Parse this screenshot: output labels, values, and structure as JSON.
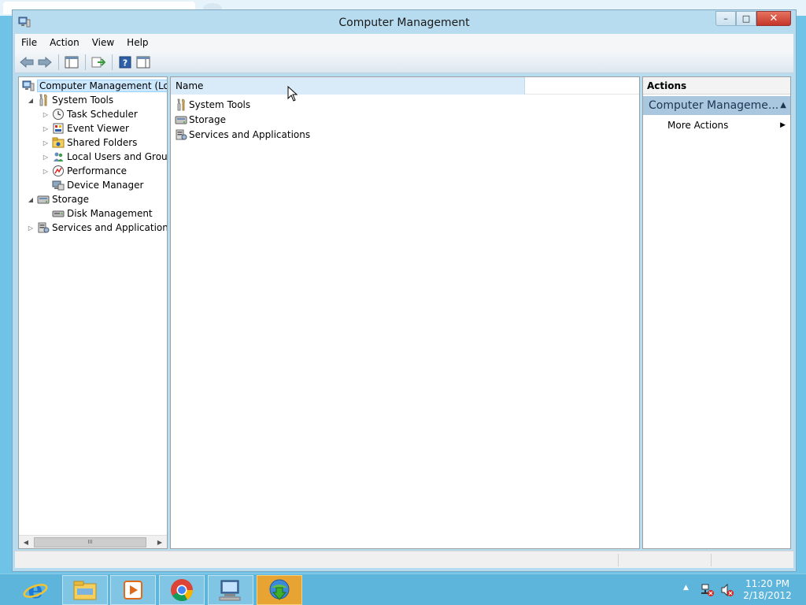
{
  "window": {
    "title": "Computer Management",
    "minimize_label": "–",
    "maximize_label": "□",
    "close_label": "✕"
  },
  "menu": [
    "File",
    "Action",
    "View",
    "Help"
  ],
  "tree": {
    "items": [
      {
        "label": "Computer Management (Local",
        "level": 0,
        "expander": "",
        "icon": "computer-management-icon",
        "selected": true
      },
      {
        "label": "System Tools",
        "level": 1,
        "expander": "◢",
        "icon": "tools-icon"
      },
      {
        "label": "Task Scheduler",
        "level": 2,
        "expander": "▷",
        "icon": "clock-icon"
      },
      {
        "label": "Event Viewer",
        "level": 2,
        "expander": "▷",
        "icon": "event-viewer-icon"
      },
      {
        "label": "Shared Folders",
        "level": 2,
        "expander": "▷",
        "icon": "shared-folders-icon"
      },
      {
        "label": "Local Users and Groups",
        "level": 2,
        "expander": "▷",
        "icon": "users-icon"
      },
      {
        "label": "Performance",
        "level": 2,
        "expander": "▷",
        "icon": "performance-icon"
      },
      {
        "label": "Device Manager",
        "level": 2,
        "expander": "",
        "icon": "device-manager-icon"
      },
      {
        "label": "Storage",
        "level": 1,
        "expander": "◢",
        "icon": "storage-icon"
      },
      {
        "label": "Disk Management",
        "level": 2,
        "expander": "",
        "icon": "disk-icon"
      },
      {
        "label": "Services and Applications",
        "level": 1,
        "expander": "▷",
        "icon": "services-icon"
      }
    ],
    "scroll_grip": "III"
  },
  "list": {
    "column_name": "Name",
    "rows": [
      {
        "label": "System Tools",
        "icon": "tools-icon"
      },
      {
        "label": "Storage",
        "icon": "storage-icon"
      },
      {
        "label": "Services and Applications",
        "icon": "services-icon"
      }
    ]
  },
  "actions": {
    "header": "Actions",
    "section": "Computer Manageme...",
    "more": "More Actions"
  },
  "taskbar": {
    "apps": [
      "internet-explorer-icon",
      "file-explorer-icon",
      "media-player-icon",
      "chrome-icon",
      "computer-management-icon",
      "download-manager-icon"
    ],
    "time": "11:20 PM",
    "date": "2/18/2012"
  },
  "colors": {
    "taskbar": "#5db5dc",
    "window_frame": "#b8dcef",
    "selection": "#cce8ff",
    "actions_section": "#a9c8e0",
    "active_task": "#e8a432"
  }
}
